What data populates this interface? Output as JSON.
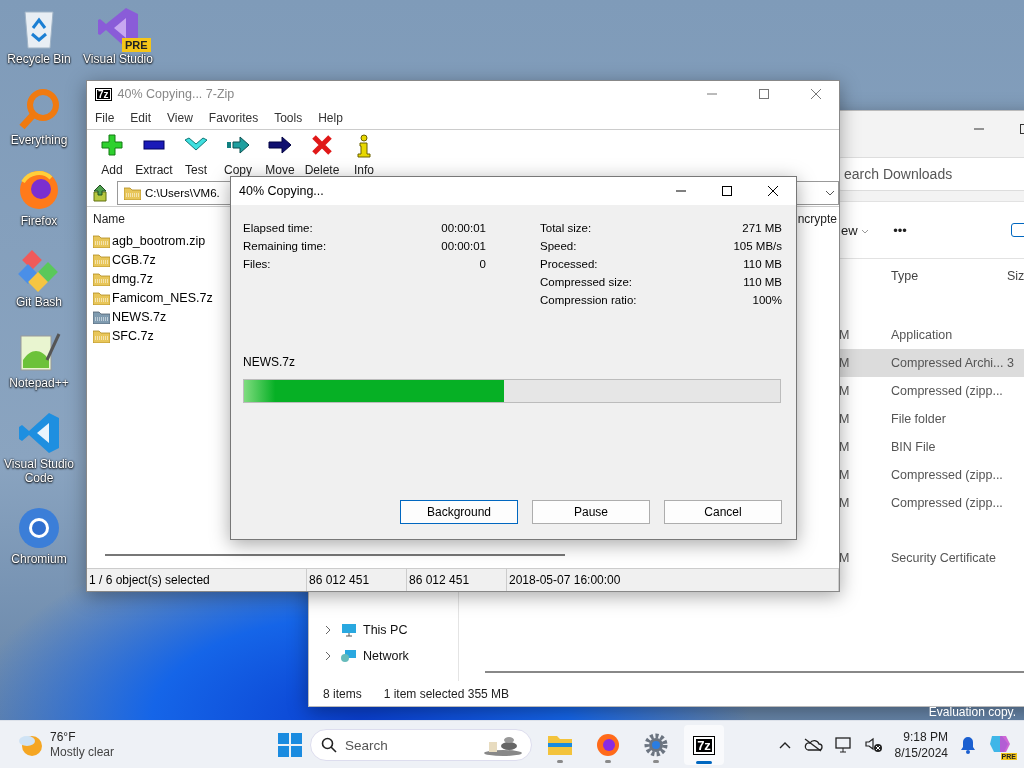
{
  "desktop_icons": [
    {
      "label": "Recycle Bin",
      "kind": "recycle"
    },
    {
      "label": "Everything",
      "kind": "everything"
    },
    {
      "label": "Firefox",
      "kind": "firefox"
    },
    {
      "label": "Git Bash",
      "kind": "git"
    },
    {
      "label": "Notepad++",
      "kind": "notepad"
    },
    {
      "label": "Visual Studio Code",
      "kind": "vscode"
    },
    {
      "label": "Chromium",
      "kind": "chromium"
    }
  ],
  "desktop_icons_col2": [
    {
      "label": "Visual Studio",
      "badge": "PRE",
      "kind": "vs"
    }
  ],
  "explorer": {
    "search_placeholder": "earch Downloads",
    "view_menu": "ew",
    "more": "•••",
    "columns": [
      "Type",
      "Siz"
    ],
    "rows": [
      {
        "column_1": "M",
        "type": "Application",
        "size": "",
        "selected": false
      },
      {
        "column_1": "M",
        "type": "Compressed Archi...",
        "size": "3",
        "selected": true
      },
      {
        "column_1": "M",
        "type": "Compressed (zipp...",
        "size": "",
        "selected": false
      },
      {
        "column_1": "M",
        "type": "File folder",
        "size": "",
        "selected": false
      },
      {
        "column_1": "M",
        "type": "BIN File",
        "size": "",
        "selected": false
      },
      {
        "column_1": "M",
        "type": "Compressed (zipp...",
        "size": "",
        "selected": false
      },
      {
        "column_1": "M",
        "type": "Compressed (zipp...",
        "size": "",
        "selected": false
      },
      {
        "column_1": "M",
        "type": "Security Certificate",
        "size": "",
        "selected": false
      }
    ],
    "nav_items": [
      {
        "label": "This PC",
        "kind": "pc"
      },
      {
        "label": "Network",
        "kind": "network"
      }
    ],
    "status": {
      "items": "8 items",
      "selection": "1 item selected  355 MB"
    }
  },
  "sevenzip": {
    "title": "40% Copying... 7-Zip",
    "app_icon": "7z",
    "menu": [
      "File",
      "Edit",
      "View",
      "Favorites",
      "Tools",
      "Help"
    ],
    "toolbar": [
      {
        "label": "Add",
        "kind": "add"
      },
      {
        "label": "Extract",
        "kind": "extract"
      },
      {
        "label": "Test",
        "kind": "test"
      },
      {
        "label": "Copy",
        "kind": "copy"
      },
      {
        "label": "Move",
        "kind": "move"
      },
      {
        "label": "Delete",
        "kind": "delete"
      },
      {
        "label": "Info",
        "kind": "info"
      }
    ],
    "path": "C:\\Users\\VM6.",
    "columns": [
      "Name",
      "ncrypte"
    ],
    "files": [
      {
        "name": "agb_bootrom.zip",
        "dimmed": false
      },
      {
        "name": "CGB.7z",
        "dimmed": false
      },
      {
        "name": "dmg.7z",
        "dimmed": false
      },
      {
        "name": "Famicom_NES.7z",
        "dimmed": false
      },
      {
        "name": "NEWS.7z",
        "dimmed": true
      },
      {
        "name": "SFC.7z",
        "dimmed": false
      }
    ],
    "status": [
      "1 / 6 object(s) selected",
      "86 012 451",
      "86 012 451",
      "2018-05-07 16:00:00"
    ]
  },
  "dialog": {
    "title": "40% Copying...",
    "left_stats": [
      {
        "label": "Elapsed time:",
        "value": "00:00:01"
      },
      {
        "label": "Remaining time:",
        "value": "00:00:01"
      },
      {
        "label": "Files:",
        "value": "0"
      }
    ],
    "right_stats": [
      {
        "label": "Total size:",
        "value": "271 MB"
      },
      {
        "label": "Speed:",
        "value": "105 MB/s"
      },
      {
        "label": "Processed:",
        "value": "110 MB"
      },
      {
        "label": "Compressed size:",
        "value": "110 MB"
      },
      {
        "label": "Compression ratio:",
        "value": "100%"
      }
    ],
    "current_file": "NEWS.7z",
    "level": 0.485,
    "buttons": [
      {
        "label": "Background",
        "focused": true
      },
      {
        "label": "Pause",
        "focused": false
      },
      {
        "label": "Cancel",
        "focused": false
      }
    ]
  },
  "watermark_text": "Evaluation copy.",
  "taskbar": {
    "weather": {
      "temp": "76°F",
      "condition": "Mostly clear"
    },
    "search_placeholder": "Search",
    "apps": [
      {
        "kind": "explorer",
        "active": false
      },
      {
        "kind": "firefox",
        "active": false
      },
      {
        "kind": "settings",
        "active": false
      },
      {
        "kind": "sevenzip",
        "label": "7z",
        "active": true
      }
    ],
    "time": "9:18 PM",
    "date": "8/15/2024",
    "copilot_badge": "PRE"
  }
}
